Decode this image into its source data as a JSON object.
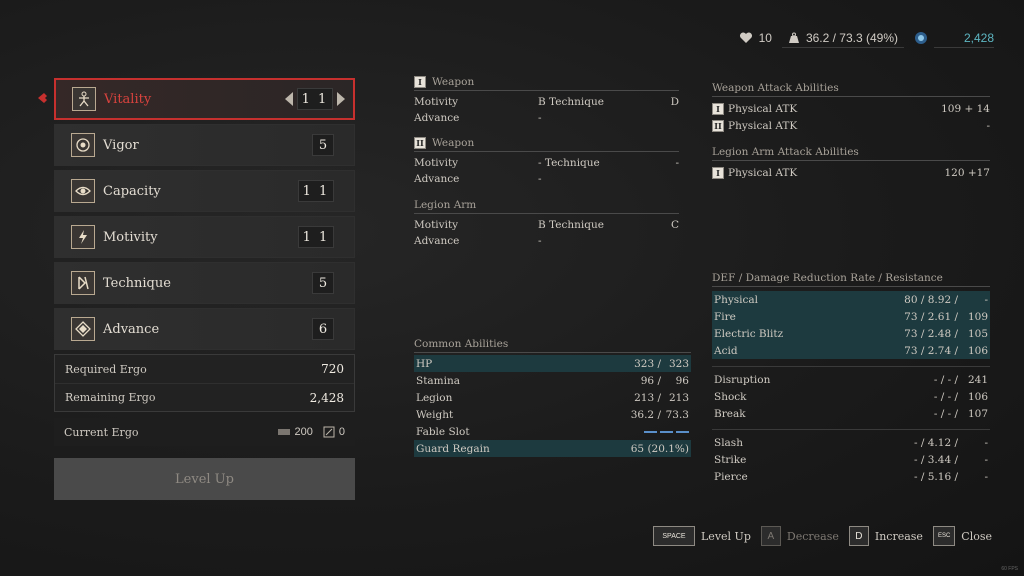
{
  "topbar": {
    "lives": "10",
    "weight": "36.2 / 73.3 (49%)",
    "ergo_total": "2,428"
  },
  "stats": [
    {
      "label": "Vitality",
      "value": "1 1",
      "selected": true
    },
    {
      "label": "Vigor",
      "value": "5"
    },
    {
      "label": "Capacity",
      "value": "1 1"
    },
    {
      "label": "Motivity",
      "value": "1 1"
    },
    {
      "label": "Technique",
      "value": "5"
    },
    {
      "label": "Advance",
      "value": "6"
    }
  ],
  "ergo": {
    "required_label": "Required Ergo",
    "required": "720",
    "remaining_label": "Remaining Ergo",
    "remaining": "2,428",
    "current_label": "Current Ergo",
    "current_a": "200",
    "current_b": "0"
  },
  "level_up_label": "Level Up",
  "weapon1": {
    "num": "I",
    "title": "Weapon",
    "rows": [
      {
        "a": "Motivity",
        "b": "B Technique",
        "c": "D"
      },
      {
        "a": "Advance",
        "b": "-",
        "c": ""
      }
    ]
  },
  "weapon2": {
    "num": "II",
    "title": "Weapon",
    "rows": [
      {
        "a": "Motivity",
        "b": "- Technique",
        "c": "-"
      },
      {
        "a": "Advance",
        "b": "-",
        "c": ""
      }
    ]
  },
  "legion": {
    "title": "Legion Arm",
    "rows": [
      {
        "a": "Motivity",
        "b": "B Technique",
        "c": "C"
      },
      {
        "a": "Advance",
        "b": "-",
        "c": ""
      }
    ]
  },
  "common": {
    "title": "Common Abilities",
    "rows": [
      {
        "n": "HP",
        "v1": "323 /",
        "v2": "323",
        "hl": true
      },
      {
        "n": "Stamina",
        "v1": "96 /",
        "v2": "96"
      },
      {
        "n": "Legion",
        "v1": "213 /",
        "v2": "213"
      },
      {
        "n": "Weight",
        "v1": "36.2 /",
        "v2": "73.3"
      },
      {
        "n": "Fable Slot"
      },
      {
        "n": "Guard Regain",
        "vw": "65 (20.1%)",
        "hl": true
      }
    ]
  },
  "weapon_attack": {
    "title": "Weapon Attack Abilities",
    "rows": [
      {
        "num": "I",
        "n": "Physical ATK",
        "v": "109 + 14"
      },
      {
        "num": "II",
        "n": "Physical ATK",
        "v": "-"
      }
    ]
  },
  "legion_attack": {
    "title": "Legion Arm Attack Abilities",
    "rows": [
      {
        "num": "I",
        "n": "Physical ATK",
        "v": "120 +17"
      }
    ]
  },
  "defense": {
    "title": "DEF / Damage Reduction Rate / Resistance",
    "group1": [
      {
        "n": "Physical",
        "d1": "80 / 8.92 /",
        "d2": "-"
      },
      {
        "n": "Fire",
        "d1": "73 / 2.61 /",
        "d2": "109"
      },
      {
        "n": "Electric Blitz",
        "d1": "73 / 2.48 /",
        "d2": "105"
      },
      {
        "n": "Acid",
        "d1": "73 / 2.74 /",
        "d2": "106"
      }
    ],
    "group2": [
      {
        "n": "Disruption",
        "d1": "- / - /",
        "d2": "241"
      },
      {
        "n": "Shock",
        "d1": "- / - /",
        "d2": "106"
      },
      {
        "n": "Break",
        "d1": "- / - /",
        "d2": "107"
      }
    ],
    "group3": [
      {
        "n": "Slash",
        "d1": "- / 4.12 /",
        "d2": "-"
      },
      {
        "n": "Strike",
        "d1": "- / 3.44 /",
        "d2": "-"
      },
      {
        "n": "Pierce",
        "d1": "- / 5.16 /",
        "d2": "-"
      }
    ]
  },
  "prompts": [
    {
      "key": "SPACE",
      "label": "Level Up"
    },
    {
      "key": "A",
      "label": "Decrease"
    },
    {
      "key": "D",
      "label": "Increase"
    },
    {
      "key": "ESC",
      "label": "Close"
    }
  ],
  "fps": "60 FPS",
  "colors": {
    "accent_red": "#c7302e",
    "teal": "#5db6c2",
    "highlight": "#1d3a3f"
  }
}
